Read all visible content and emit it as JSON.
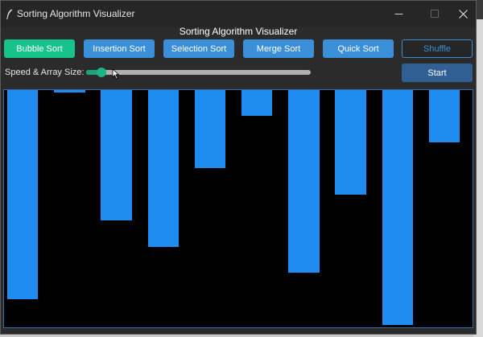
{
  "window": {
    "title": "Sorting Algorithm Visualizer",
    "header": "Sorting Algorithm Visualizer"
  },
  "toolbar": {
    "algorithms": [
      {
        "label": "Bubble Sort",
        "selected": true
      },
      {
        "label": "Insertion Sort",
        "selected": false
      },
      {
        "label": "Selection Sort",
        "selected": false
      },
      {
        "label": "Merge Sort",
        "selected": false
      },
      {
        "label": "Quick Sort",
        "selected": false
      }
    ],
    "shuffle_label": "Shuffle",
    "start_label": "Start"
  },
  "slider": {
    "label": "Speed & Array Size:",
    "value": 0.05
  },
  "visualizer": {
    "bar_values": [
      88,
      1,
      55,
      66,
      33,
      11,
      77,
      44,
      99,
      22
    ],
    "max_value": 100
  },
  "colors": {
    "bar": "#1f8cf2",
    "selected_button": "#17c38a",
    "button": "#3a8fd8",
    "canvas_bg": "#000000"
  },
  "icons": {
    "app": "feather-icon",
    "minimize": "minimize-icon",
    "maximize": "maximize-icon",
    "close": "close-icon",
    "cursor": "mouse-pointer-icon"
  }
}
